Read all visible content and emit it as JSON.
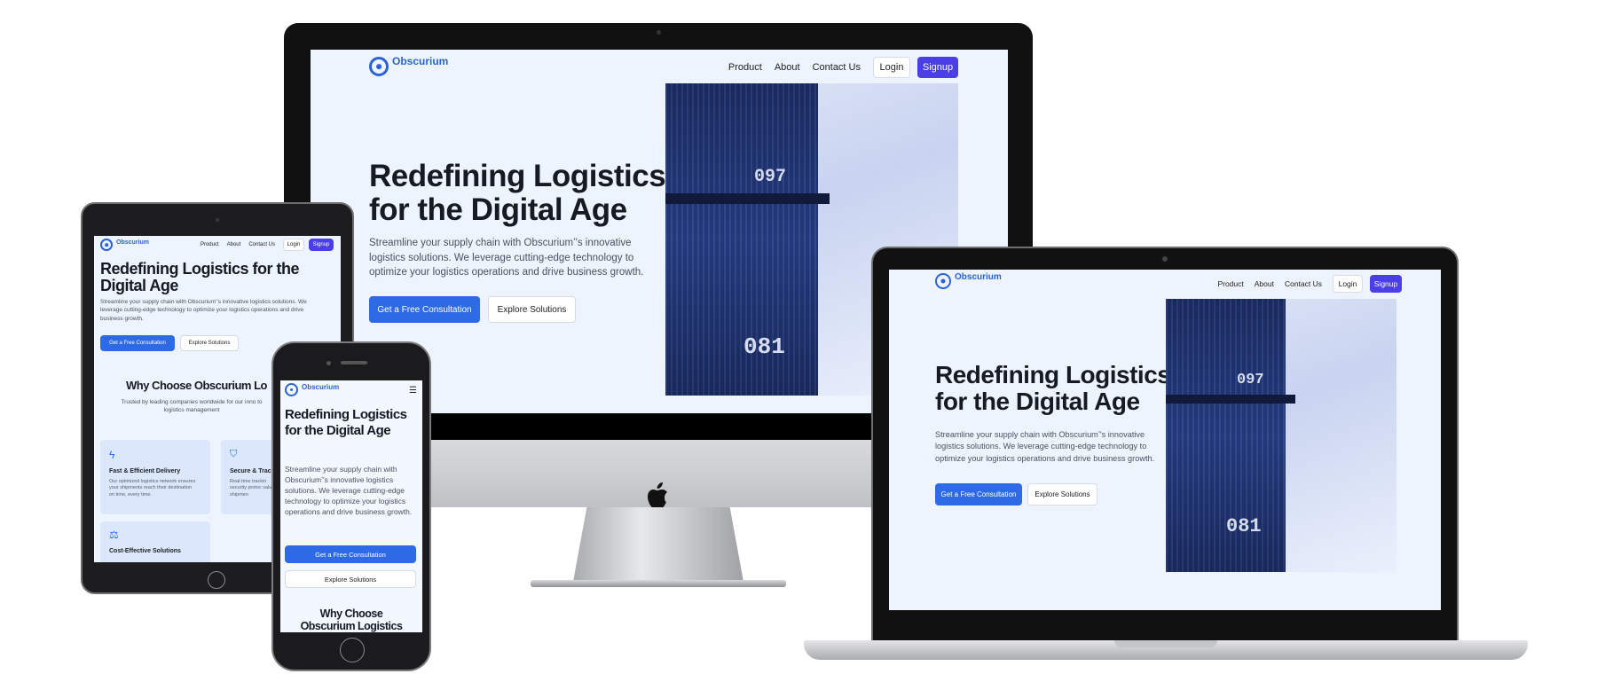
{
  "brand": {
    "name": "Obscurium",
    "accent": "#2f6ae6",
    "signup_color": "#4a3ee6"
  },
  "nav": {
    "product": "Product",
    "about": "About",
    "contact": "Contact Us",
    "login": "Login",
    "signup": "Signup"
  },
  "hero": {
    "title_line1": "Redefining Logistics",
    "title_line2": "for the Digital Age",
    "title_full": "Redefining Logistics for the Digital Age",
    "mobile_title": "Redefining Logistics for the Digital Age",
    "lead": "Streamline your supply chain with Obscuriumʼ's innovative logistics solutions. We leverage cutting-edge technology to optimize your logistics operations and drive business growth.",
    "primary_cta": "Get a Free Consultation",
    "secondary_cta": "Explore Solutions",
    "container_codes": [
      "097",
      "081"
    ]
  },
  "why": {
    "title_tablet": "Why Choose Obscurium Lo",
    "title_mobile_line1": "Why Choose",
    "title_mobile_line2": "Obscurium Logistics",
    "subtitle": "Trusted by leading companies worldwide for our inno to logistics management",
    "cards": [
      {
        "icon": "lightning-icon",
        "title": "Fast & Efficient Delivery",
        "desc": "Our optimized logistics network ensures your shipments reach their destination on time, every time."
      },
      {
        "icon": "shield-icon",
        "title": "Secure & Trac",
        "desc": "Real-time trackin security protoc valuable shipmen"
      },
      {
        "icon": "scale-icon",
        "title": "Cost-Effective Solutions",
        "desc": ""
      }
    ]
  },
  "menu_icon": "hamburger-icon",
  "device_logo": "apple-logo-icon"
}
